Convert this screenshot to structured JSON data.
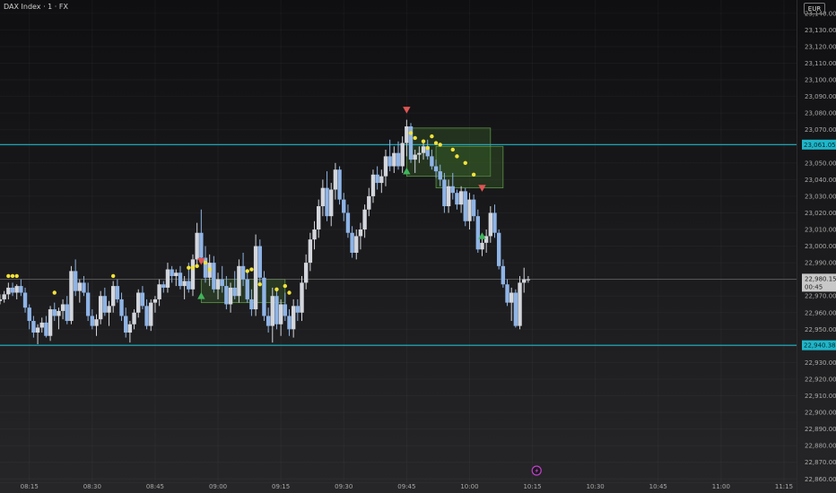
{
  "header": {
    "title": "DAX Index · 1 · FX",
    "currency": "EUR"
  },
  "price_labels": {
    "upper_level": "23,061.05",
    "lower_level": "22,940.38",
    "last_price": "22,980.15",
    "countdown": "00:45"
  },
  "colors": {
    "background": "#121214",
    "candle_up": "#d3d6dc",
    "candle_down": "#8fb4e6",
    "level_line": "#1fb6c9",
    "signal_dot": "#f2e23a",
    "signal_up": "#3fb55a",
    "signal_down": "#e05454",
    "zone_fill": "#3d6b2c",
    "zone_border": "#6db150",
    "axis_text": "#a9a9a9",
    "last_price_line": "#666666",
    "lightning_icon": "#c13fcd"
  },
  "icons": {
    "event": "lightning-icon"
  },
  "chart_data": {
    "type": "candlestick",
    "y_axis": {
      "range": [
        22858,
        23148
      ],
      "ticks": [
        22860,
        22870,
        22880,
        22890,
        22900,
        22910,
        22920,
        22930,
        22940,
        22950,
        22960,
        22970,
        22980,
        22990,
        23000,
        23010,
        23020,
        23030,
        23040,
        23050,
        23060,
        23070,
        23080,
        23090,
        23100,
        23110,
        23120,
        23130,
        23140
      ],
      "tick_labels": [
        "22,860.00",
        "22,870.00",
        "22,880.00",
        "22,890.00",
        "22,900.00",
        "22,910.00",
        "22,920.00",
        "22,930.00",
        "22,940.00",
        "22,950.00",
        "22,960.00",
        "22,970.00",
        "22,980.00",
        "22,990.00",
        "23,000.00",
        "23,010.00",
        "23,020.00",
        "23,030.00",
        "23,040.00",
        "23,050.00",
        "23,060.00",
        "23,070.00",
        "23,080.00",
        "23,090.00",
        "23,100.00",
        "23,110.00",
        "23,120.00",
        "23,130.00",
        "23,140.00"
      ]
    },
    "x_axis": {
      "range": [
        "08:08",
        "11:18"
      ],
      "ticks": [
        "08:15",
        "08:30",
        "08:45",
        "09:00",
        "09:15",
        "09:30",
        "09:45",
        "10:00",
        "10:15",
        "10:30",
        "10:45",
        "11:00",
        "11:15"
      ]
    },
    "levels": [
      23061.05,
      22940.38
    ],
    "last_price": 22980.15,
    "candles": [
      [
        "08:08",
        22967,
        22971,
        22965,
        22968
      ],
      [
        "08:09",
        22968,
        22973,
        22966,
        22971
      ],
      [
        "08:10",
        22971,
        22978,
        22968,
        22975
      ],
      [
        "08:11",
        22975,
        22978,
        22970,
        22972
      ],
      [
        "08:12",
        22972,
        22977,
        22968,
        22976
      ],
      [
        "08:13",
        22976,
        22980,
        22970,
        22972
      ],
      [
        "08:14",
        22972,
        22975,
        22960,
        22963
      ],
      [
        "08:15",
        22963,
        22965,
        22950,
        22955
      ],
      [
        "08:16",
        22955,
        22958,
        22945,
        22948
      ],
      [
        "08:17",
        22948,
        22953,
        22941,
        22951
      ],
      [
        "08:18",
        22951,
        22957,
        22948,
        22954
      ],
      [
        "08:19",
        22954,
        22958,
        22945,
        22946
      ],
      [
        "08:20",
        22946,
        22964,
        22943,
        22962
      ],
      [
        "08:21",
        22962,
        22966,
        22955,
        22958
      ],
      [
        "08:22",
        22958,
        22963,
        22950,
        22961
      ],
      [
        "08:23",
        22961,
        22968,
        22956,
        22965
      ],
      [
        "08:24",
        22965,
        22970,
        22953,
        22955
      ],
      [
        "08:25",
        22955,
        22988,
        22953,
        22985
      ],
      [
        "08:26",
        22985,
        22992,
        22970,
        22973
      ],
      [
        "08:27",
        22973,
        22980,
        22966,
        22978
      ],
      [
        "08:28",
        22978,
        22982,
        22970,
        22972
      ],
      [
        "08:29",
        22972,
        22978,
        22955,
        22958
      ],
      [
        "08:30",
        22958,
        22962,
        22950,
        22952
      ],
      [
        "08:31",
        22952,
        22959,
        22946,
        22956
      ],
      [
        "08:32",
        22956,
        22973,
        22953,
        22970
      ],
      [
        "08:33",
        22970,
        22975,
        22958,
        22960
      ],
      [
        "08:34",
        22960,
        22967,
        22952,
        22964
      ],
      [
        "08:35",
        22964,
        22979,
        22960,
        22976
      ],
      [
        "08:36",
        22976,
        22980,
        22966,
        22968
      ],
      [
        "08:37",
        22968,
        22972,
        22955,
        22958
      ],
      [
        "08:38",
        22958,
        22963,
        22945,
        22948
      ],
      [
        "08:39",
        22948,
        22955,
        22942,
        22953
      ],
      [
        "08:40",
        22953,
        22962,
        22950,
        22960
      ],
      [
        "08:41",
        22960,
        22974,
        22957,
        22972
      ],
      [
        "08:42",
        22972,
        22976,
        22962,
        22964
      ],
      [
        "08:43",
        22964,
        22968,
        22950,
        22952
      ],
      [
        "08:44",
        22952,
        22968,
        22949,
        22966
      ],
      [
        "08:45",
        22966,
        22970,
        22960,
        22968
      ],
      [
        "08:46",
        22968,
        22980,
        22964,
        22977
      ],
      [
        "08:47",
        22977,
        22979,
        22972,
        22975
      ],
      [
        "08:48",
        22975,
        22990,
        22972,
        22986
      ],
      [
        "08:49",
        22986,
        22988,
        22978,
        22982
      ],
      [
        "08:50",
        22982,
        22986,
        22976,
        22984
      ],
      [
        "08:51",
        22984,
        22988,
        22974,
        22976
      ],
      [
        "08:52",
        22976,
        22982,
        22968,
        22979
      ],
      [
        "08:53",
        22979,
        22990,
        22972,
        22974
      ],
      [
        "08:54",
        22974,
        22995,
        22970,
        22992
      ],
      [
        "08:55",
        22992,
        23014,
        22988,
        23008
      ],
      [
        "08:56",
        23008,
        23022,
        22990,
        22993
      ],
      [
        "08:57",
        22993,
        23000,
        22978,
        22981
      ],
      [
        "08:58",
        22981,
        22995,
        22976,
        22990
      ],
      [
        "08:59",
        22990,
        22994,
        22972,
        22974
      ],
      [
        "09:00",
        22974,
        22984,
        22968,
        22980
      ],
      [
        "09:01",
        22980,
        22988,
        22972,
        22976
      ],
      [
        "09:02",
        22976,
        22982,
        22962,
        22965
      ],
      [
        "09:03",
        22965,
        22978,
        22960,
        22975
      ],
      [
        "09:04",
        22975,
        22985,
        22968,
        22970
      ],
      [
        "09:05",
        22970,
        22992,
        22966,
        22988
      ],
      [
        "09:06",
        22988,
        22996,
        22976,
        22980
      ],
      [
        "09:07",
        22980,
        22984,
        22966,
        22968
      ],
      [
        "09:08",
        22968,
        22974,
        22958,
        22962
      ],
      [
        "09:09",
        22962,
        23007,
        22958,
        23000
      ],
      [
        "09:10",
        23000,
        23004,
        22978,
        22981
      ],
      [
        "09:11",
        22981,
        22985,
        22955,
        22958
      ],
      [
        "09:12",
        22958,
        22963,
        22948,
        22952
      ],
      [
        "09:13",
        22952,
        22975,
        22942,
        22970
      ],
      [
        "09:14",
        22970,
        22974,
        22950,
        22953
      ],
      [
        "09:15",
        22953,
        22968,
        22946,
        22965
      ],
      [
        "09:16",
        22965,
        22972,
        22955,
        22958
      ],
      [
        "09:17",
        22958,
        22962,
        22946,
        22950
      ],
      [
        "09:18",
        22950,
        22968,
        22945,
        22964
      ],
      [
        "09:19",
        22964,
        22968,
        22955,
        22960
      ],
      [
        "09:20",
        22960,
        22982,
        22955,
        22978
      ],
      [
        "09:21",
        22978,
        22995,
        22974,
        22990
      ],
      [
        "09:22",
        22990,
        23008,
        22985,
        23004
      ],
      [
        "09:23",
        23004,
        23015,
        22998,
        23010
      ],
      [
        "09:24",
        23010,
        23028,
        23005,
        23024
      ],
      [
        "09:25",
        23024,
        23040,
        23018,
        23035
      ],
      [
        "09:26",
        23035,
        23045,
        23015,
        23018
      ],
      [
        "09:27",
        23018,
        23038,
        23012,
        23034
      ],
      [
        "09:28",
        23034,
        23050,
        23028,
        23046
      ],
      [
        "09:29",
        23046,
        23048,
        23025,
        23028
      ],
      [
        "09:30",
        23028,
        23032,
        23015,
        23020
      ],
      [
        "09:31",
        23020,
        23025,
        23005,
        23008
      ],
      [
        "09:32",
        23008,
        23012,
        22993,
        22996
      ],
      [
        "09:33",
        22996,
        23010,
        22992,
        23006
      ],
      [
        "09:34",
        23006,
        23014,
        22998,
        23010
      ],
      [
        "09:35",
        23010,
        23025,
        23005,
        23022
      ],
      [
        "09:36",
        23022,
        23035,
        23018,
        23030
      ],
      [
        "09:37",
        23030,
        23046,
        23026,
        23043
      ],
      [
        "09:38",
        23043,
        23048,
        23034,
        23038
      ],
      [
        "09:39",
        23038,
        23046,
        23032,
        23042
      ],
      [
        "09:40",
        23042,
        23058,
        23036,
        23054
      ],
      [
        "09:41",
        23054,
        23064,
        23045,
        23048
      ],
      [
        "09:42",
        23048,
        23060,
        23044,
        23056
      ],
      [
        "09:43",
        23056,
        23063,
        23046,
        23048
      ],
      [
        "09:44",
        23048,
        23066,
        23044,
        23062
      ],
      [
        "09:45",
        23062,
        23076,
        23054,
        23072
      ],
      [
        "09:46",
        23072,
        23074,
        23050,
        23052
      ],
      [
        "09:47",
        23052,
        23058,
        23044,
        23055
      ],
      [
        "09:48",
        23055,
        23060,
        23050,
        23056
      ],
      [
        "09:49",
        23056,
        23062,
        23052,
        23060
      ],
      [
        "09:50",
        23060,
        23064,
        23052,
        23054
      ],
      [
        "09:51",
        23054,
        23058,
        23046,
        23048
      ],
      [
        "09:52",
        23048,
        23052,
        23041,
        23045
      ],
      [
        "09:53",
        23045,
        23049,
        23036,
        23040
      ],
      [
        "09:54",
        23040,
        23044,
        23020,
        23024
      ],
      [
        "09:55",
        23024,
        23040,
        23020,
        23036
      ],
      [
        "09:56",
        23036,
        23044,
        23028,
        23032
      ],
      [
        "09:57",
        23032,
        23034,
        23022,
        23025
      ],
      [
        "09:58",
        23025,
        23036,
        23020,
        23033
      ],
      [
        "09:59",
        23033,
        23035,
        23012,
        23015
      ],
      [
        "10:00",
        23015,
        23032,
        23010,
        23028
      ],
      [
        "10:01",
        23028,
        23031,
        23015,
        23018
      ],
      [
        "10:02",
        23018,
        23022,
        22996,
        22998
      ],
      [
        "10:03",
        22998,
        23006,
        22994,
        23002
      ],
      [
        "10:04",
        23002,
        23010,
        22996,
        23006
      ],
      [
        "10:05",
        23006,
        23024,
        23002,
        23020
      ],
      [
        "10:06",
        23020,
        23025,
        23005,
        23008
      ],
      [
        "10:07",
        23008,
        23010,
        22986,
        22988
      ],
      [
        "10:08",
        22988,
        22992,
        22975,
        22977
      ],
      [
        "10:09",
        22977,
        22980,
        22964,
        22966
      ],
      [
        "10:10",
        22966,
        22975,
        22955,
        22972
      ],
      [
        "10:11",
        22972,
        22974,
        22951,
        22952
      ],
      [
        "10:12",
        22952,
        22982,
        22950,
        22978
      ],
      [
        "10:13",
        22978,
        22987,
        22972,
        22980
      ],
      [
        "10:14",
        22980,
        22982,
        22978,
        22980
      ]
    ],
    "zones": [
      {
        "from": "08:56",
        "to": "09:16",
        "low": 22966,
        "high": 22980
      },
      {
        "from": "09:45",
        "to": "10:05",
        "low": 23042,
        "high": 23071
      },
      {
        "from": "09:52",
        "to": "10:08",
        "low": 23035,
        "high": 23060
      }
    ],
    "dots": [
      [
        "08:10",
        22982
      ],
      [
        "08:11",
        22982
      ],
      [
        "08:12",
        22982
      ],
      [
        "08:21",
        22972
      ],
      [
        "08:35",
        22982
      ],
      [
        "08:53",
        22987
      ],
      [
        "08:54",
        22987
      ],
      [
        "08:55",
        22988
      ],
      [
        "08:56",
        22991
      ],
      [
        "08:57",
        22990
      ],
      [
        "08:58",
        22986
      ],
      [
        "09:07",
        22985
      ],
      [
        "09:08",
        22986
      ],
      [
        "09:10",
        22977
      ],
      [
        "09:14",
        22974
      ],
      [
        "09:16",
        22976
      ],
      [
        "09:17",
        22972
      ],
      [
        "09:46",
        23068
      ],
      [
        "09:47",
        23065
      ],
      [
        "09:49",
        23063
      ],
      [
        "09:50",
        23059
      ],
      [
        "09:51",
        23066
      ],
      [
        "09:52",
        23062
      ],
      [
        "09:53",
        23061
      ],
      [
        "09:56",
        23058
      ],
      [
        "09:57",
        23054
      ],
      [
        "09:59",
        23050
      ],
      [
        "10:01",
        23043
      ]
    ],
    "signals": [
      {
        "time": "08:56",
        "price": 22991,
        "dir": "down"
      },
      {
        "time": "08:56",
        "price": 22970,
        "dir": "up"
      },
      {
        "time": "09:45",
        "price": 23082,
        "dir": "down"
      },
      {
        "time": "09:45",
        "price": 23045,
        "dir": "up"
      },
      {
        "time": "10:03",
        "price": 23035,
        "dir": "down"
      },
      {
        "time": "10:03",
        "price": 23006,
        "dir": "up"
      }
    ],
    "event_marker": "10:16"
  }
}
